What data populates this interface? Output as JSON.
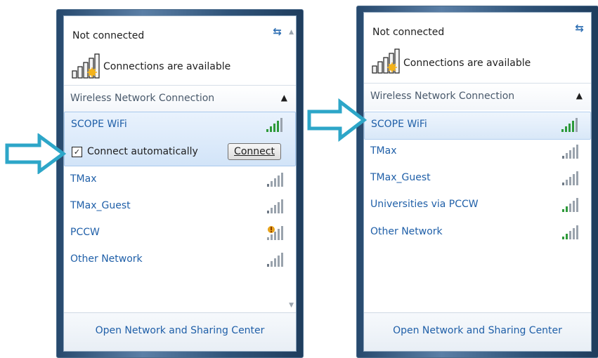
{
  "left_panel": {
    "status_title": "Not connected",
    "available_text": "Connections are available",
    "section_label": "Wireless Network Connection",
    "networks": [
      {
        "name": "SCOPE WiFi"
      },
      {
        "name": "TMax"
      },
      {
        "name": "TMax_Guest"
      },
      {
        "name": "PCCW"
      },
      {
        "name": "Other Network"
      }
    ],
    "auto_connect_label": "Connect automatically",
    "auto_connect_checked": true,
    "connect_button": "Connect",
    "footer_link": "Open Network and Sharing Center"
  },
  "right_panel": {
    "status_title": "Not connected",
    "available_text": "Connections are available",
    "section_label": "Wireless Network Connection",
    "networks": [
      {
        "name": "SCOPE WiFi"
      },
      {
        "name": "TMax"
      },
      {
        "name": "TMax_Guest"
      },
      {
        "name": "Universities via PCCW"
      },
      {
        "name": "Other Network"
      }
    ],
    "footer_link": "Open Network and Sharing Center"
  },
  "icons": {
    "refresh": "refresh-icon",
    "collapse": "chevron-up-icon",
    "signal": "wifi-signal-icon",
    "signal_secured_warning": "wifi-signal-warning-icon",
    "available": "network-available-icon",
    "pointer_arrow": "arrow-right-icon"
  },
  "colors": {
    "link": "#1f5fa8",
    "arrow": "#2da6c8",
    "signal_strong": "#2e9a3a",
    "signal_weak": "#9aa3ad"
  }
}
